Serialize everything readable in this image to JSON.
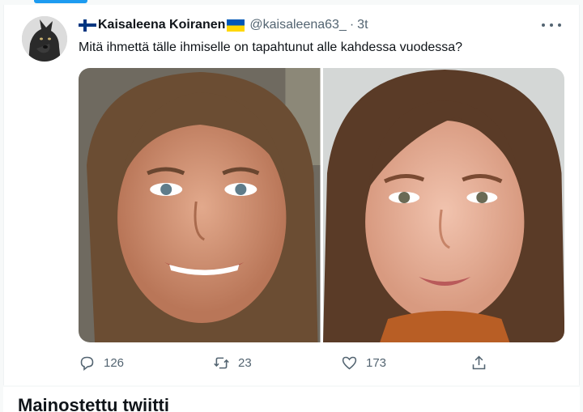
{
  "tweet": {
    "display_name": "Kaisaleena Koiranen",
    "handle": "@kaisaleena63_",
    "separator": "·",
    "timestamp": "3t",
    "text": "Mitä ihmettä tälle ihmiselle on tapahtunut alle kahdessa vuodessa?",
    "name_flags": [
      "finnish-flag",
      "ukrainian-flag"
    ]
  },
  "actions": {
    "replies": "126",
    "retweets": "23",
    "likes": "173"
  },
  "promoted": {
    "title": "Mainostettu twiitti"
  },
  "colors": {
    "accent": "#1d9bf0",
    "secondary_text": "#536471"
  }
}
